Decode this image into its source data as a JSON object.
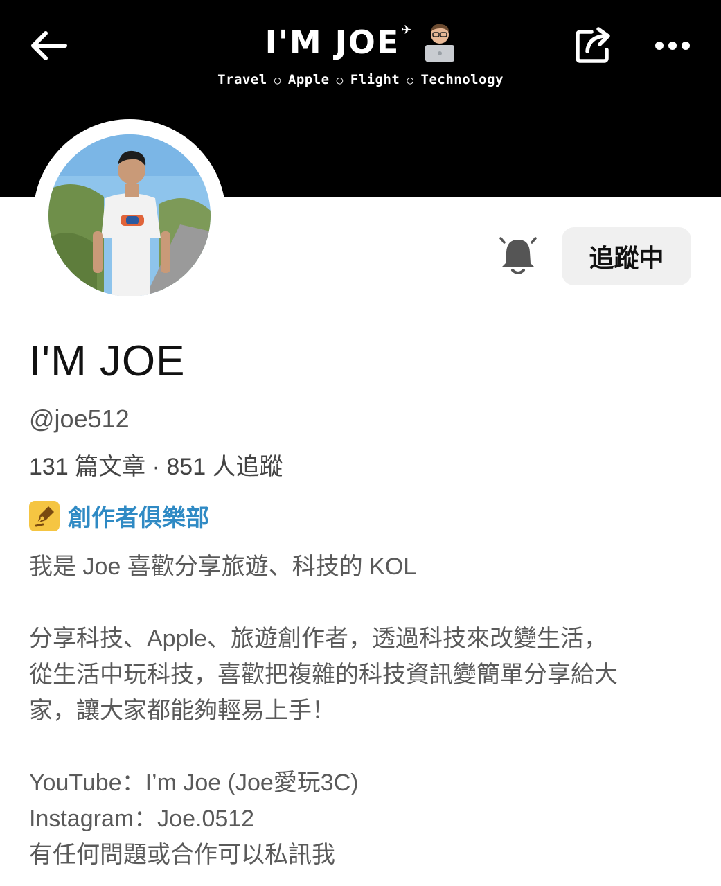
{
  "header": {
    "brand_title": "I'M JOE",
    "tagline": [
      "Travel",
      "Apple",
      "Flight",
      "Technology"
    ],
    "back_label": "Back",
    "share_label": "Share",
    "more_label": "More"
  },
  "profile": {
    "name": "I'M JOE",
    "handle": "@joe512",
    "stats": "131 篇文章 · 851 人追蹤",
    "club": "創作者俱樂部",
    "follow_label": "追蹤中"
  },
  "bio": {
    "line1": "我是 Joe 喜歡分享旅遊、科技的 KOL",
    "para1_line1": "分享科技、Apple、旅遊創作者，透過科技來改變生活，",
    "para1_line2": "從生活中玩科技，喜歡把複雜的科技資訊變簡單分享給大",
    "para1_line3": "家，讓大家都能夠輕易上手！",
    "youtube": "YouTube：I’m Joe (Joe愛玩3C)",
    "instagram": "Instagram：Joe.0512",
    "contact": "有任何問題或合作可以私訊我"
  },
  "icons": {
    "back": "arrow-left-icon",
    "share": "share-icon",
    "more": "more-dots-icon",
    "bell": "bell-icon",
    "club": "pen-icon"
  },
  "colors": {
    "banner": "#000000",
    "club_badge": "#f5c542",
    "club_text": "#2f8ac4",
    "follow_bg": "#f0f0f0"
  }
}
